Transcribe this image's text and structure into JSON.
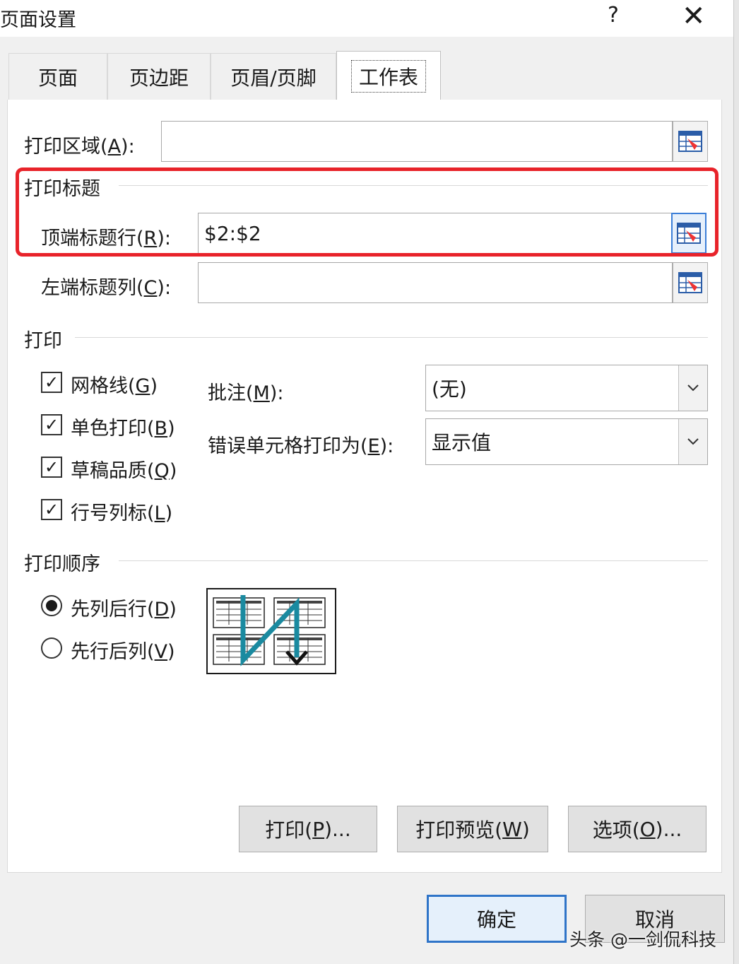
{
  "window": {
    "title": "页面设置",
    "help": "?",
    "close": "✕"
  },
  "tabs": [
    {
      "label": "页面"
    },
    {
      "label": "页边距"
    },
    {
      "label": "页眉/页脚"
    },
    {
      "label": "工作表",
      "active": true
    }
  ],
  "print_area": {
    "label": "打印区域(A):",
    "value": ""
  },
  "print_titles": {
    "group_label": "打印标题",
    "top_rows_label": "顶端标题行(R):",
    "top_rows_value": "$2:$2",
    "left_cols_label": "左端标题列(C):",
    "left_cols_value": ""
  },
  "print": {
    "group_label": "打印",
    "checkboxes": [
      {
        "label": "网格线(G)",
        "checked": true
      },
      {
        "label": "单色打印(B)",
        "checked": true
      },
      {
        "label": "草稿品质(Q)",
        "checked": true
      },
      {
        "label": "行号列标(L)",
        "checked": true
      }
    ],
    "comments_label": "批注(M):",
    "comments_value": "(无)",
    "errors_label": "错误单元格打印为(E):",
    "errors_value": "显示值"
  },
  "page_order": {
    "group_label": "打印顺序",
    "options": [
      {
        "label": "先列后行(D)",
        "selected": true
      },
      {
        "label": "先行后列(V)",
        "selected": false
      }
    ]
  },
  "buttons": {
    "print": "打印(P)...",
    "preview": "打印预览(W)",
    "options": "选项(O)...",
    "ok": "确定",
    "cancel": "取消"
  },
  "watermark": "头条 @一剑侃科技",
  "colors": {
    "highlight": "#e8232a",
    "accent": "#2f74c8",
    "order_arrow": "#1a8aa0"
  },
  "icons": {
    "range_picker": "collapse-dialog-icon",
    "dropdown": "chevron-down-icon"
  }
}
